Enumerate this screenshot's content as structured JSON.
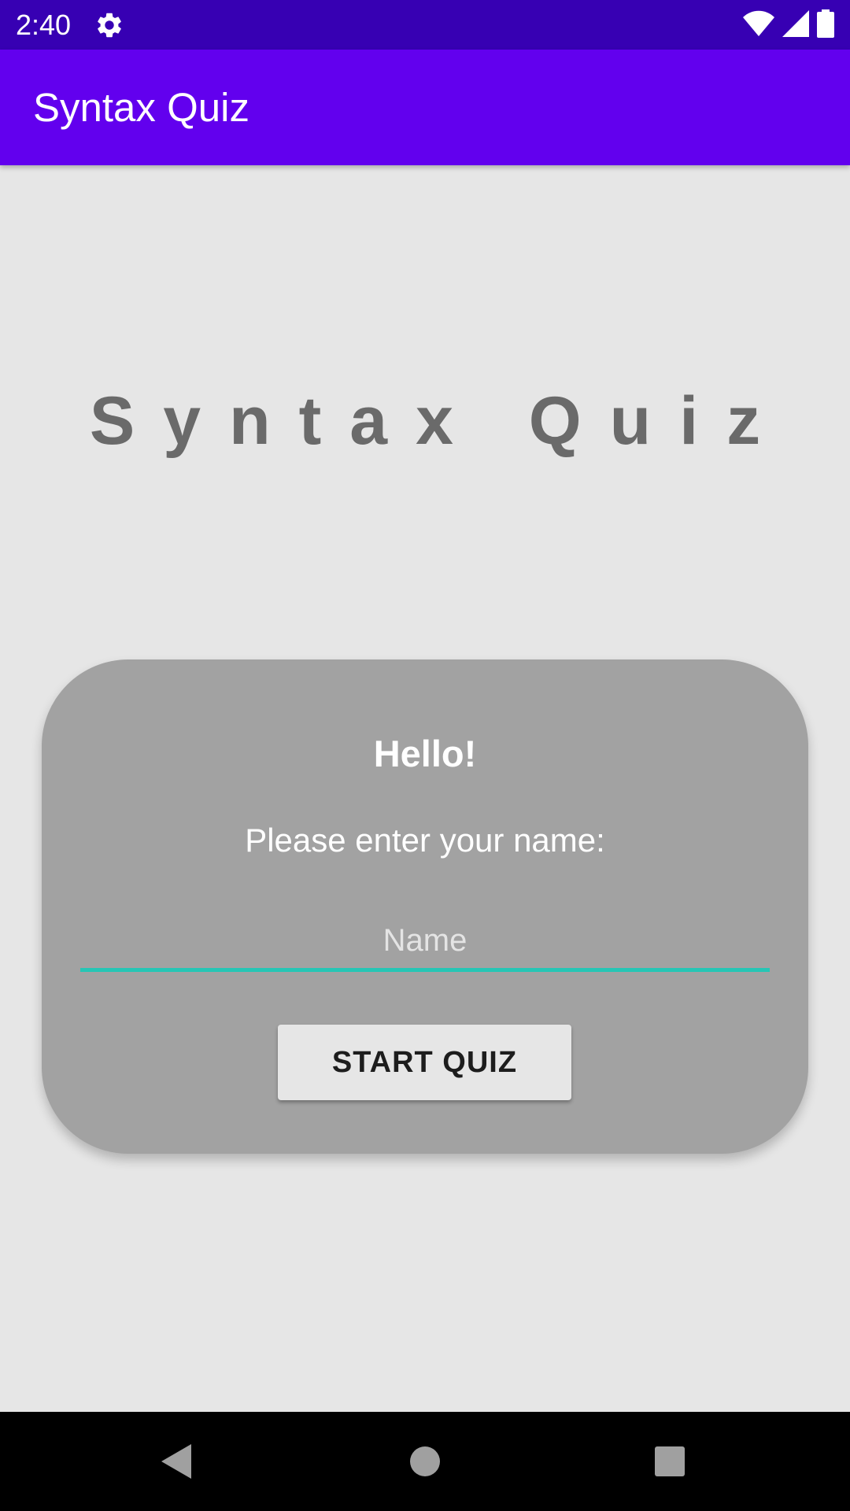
{
  "status_bar": {
    "time": "2:40",
    "icons": [
      "gear-icon",
      "wifi-icon",
      "signal-icon",
      "battery-icon"
    ]
  },
  "app_bar": {
    "title": "Syntax Quiz"
  },
  "main": {
    "title": "Syntax Quiz"
  },
  "card": {
    "greeting": "Hello!",
    "prompt": "Please enter your name:",
    "name_input": {
      "value": "",
      "placeholder": "Name"
    },
    "start_button_label": "START QUIZ"
  },
  "nav_bar": {
    "icons": [
      "back-icon",
      "home-icon",
      "recents-icon"
    ]
  },
  "colors": {
    "status_bar": "#3700b3",
    "app_bar": "#6200ee",
    "background": "#e6e6e6",
    "card": "#a2a2a2",
    "input_underline": "#26c6b5",
    "title_text": "#6a6a6a"
  }
}
